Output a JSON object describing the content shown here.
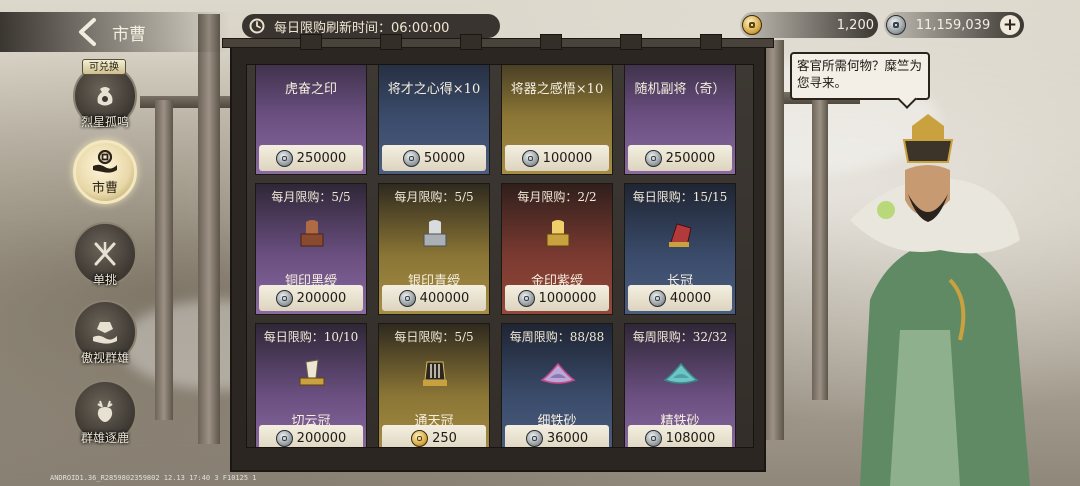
{
  "header": {
    "back_icon": "chevron-left-icon",
    "title": "市曹",
    "refresh_icon": "refresh-icon",
    "refresh_label": "每日限购刷新时间：06:00:00"
  },
  "currencies": [
    {
      "icon": "gold-coin-icon",
      "amount": "1,200"
    },
    {
      "icon": "silver-coin-icon",
      "amount": "11,159,039",
      "add_icon": "plus-icon"
    }
  ],
  "nav": {
    "exchange_tag": "可兑换",
    "items": [
      {
        "label": "烈星孤鸣",
        "icon": "coin-pouch-icon",
        "active": false
      },
      {
        "label": "市曹",
        "icon": "market-hand-icon",
        "active": true
      },
      {
        "label": "单挑",
        "icon": "crossed-swords-icon",
        "active": false
      },
      {
        "label": "傲视群雄",
        "icon": "crown-hand-icon",
        "active": false
      },
      {
        "label": "群雄逐鹿",
        "icon": "deer-icon",
        "active": false
      }
    ]
  },
  "shop": {
    "rows": [
      [
        {
          "limit": "",
          "name": "虎奋之印",
          "price": "250000",
          "color": "purple",
          "icon": "jade-seal-icon",
          "currency": "silver"
        },
        {
          "limit": "",
          "name": "将才之心得×10",
          "price": "50000",
          "color": "blue",
          "icon": "scroll-bundle-icon",
          "currency": "silver"
        },
        {
          "limit": "",
          "name": "将器之感悟×10",
          "price": "100000",
          "color": "gold",
          "icon": "scroll-bundle-icon",
          "currency": "silver"
        },
        {
          "limit": "",
          "name": "随机副将（奇）",
          "price": "250000",
          "color": "purple",
          "icon": "card-pack-icon",
          "currency": "silver"
        }
      ],
      [
        {
          "limit": "每月限购：5/5",
          "name": "铜印黑绶",
          "price": "200000",
          "color": "purple",
          "icon": "bronze-seal-icon",
          "currency": "silver"
        },
        {
          "limit": "每月限购：5/5",
          "name": "银印青绶",
          "price": "400000",
          "color": "gold",
          "icon": "silver-seal-icon",
          "currency": "silver"
        },
        {
          "limit": "每月限购：2/2",
          "name": "金印紫绶",
          "price": "1000000",
          "color": "red",
          "icon": "gold-seal-icon",
          "currency": "silver"
        },
        {
          "limit": "每日限购：15/15",
          "name": "长冠",
          "price": "40000",
          "color": "blue",
          "icon": "long-crown-icon",
          "currency": "silver"
        }
      ],
      [
        {
          "limit": "每日限购：10/10",
          "name": "切云冠",
          "price": "200000",
          "color": "purple",
          "icon": "cloud-crown-icon",
          "currency": "silver"
        },
        {
          "limit": "每日限购：5/5",
          "name": "通天冠",
          "price": "250",
          "color": "gold",
          "icon": "heaven-crown-icon",
          "currency": "gold"
        },
        {
          "limit": "每周限购：88/88",
          "name": "细铁砂",
          "price": "36000",
          "color": "blue",
          "icon": "fine-iron-sand-icon",
          "currency": "silver"
        },
        {
          "limit": "每周限购：32/32",
          "name": "精铁砂",
          "price": "108000",
          "color": "purple",
          "icon": "refined-iron-sand-icon",
          "currency": "silver"
        }
      ]
    ]
  },
  "npc": {
    "speech": "客官所需何物？糜竺为您寻来。"
  },
  "footer": {
    "build_id": "ANDROID1.36_R2859802359802 12.13 17:40 3 F10125 1"
  }
}
